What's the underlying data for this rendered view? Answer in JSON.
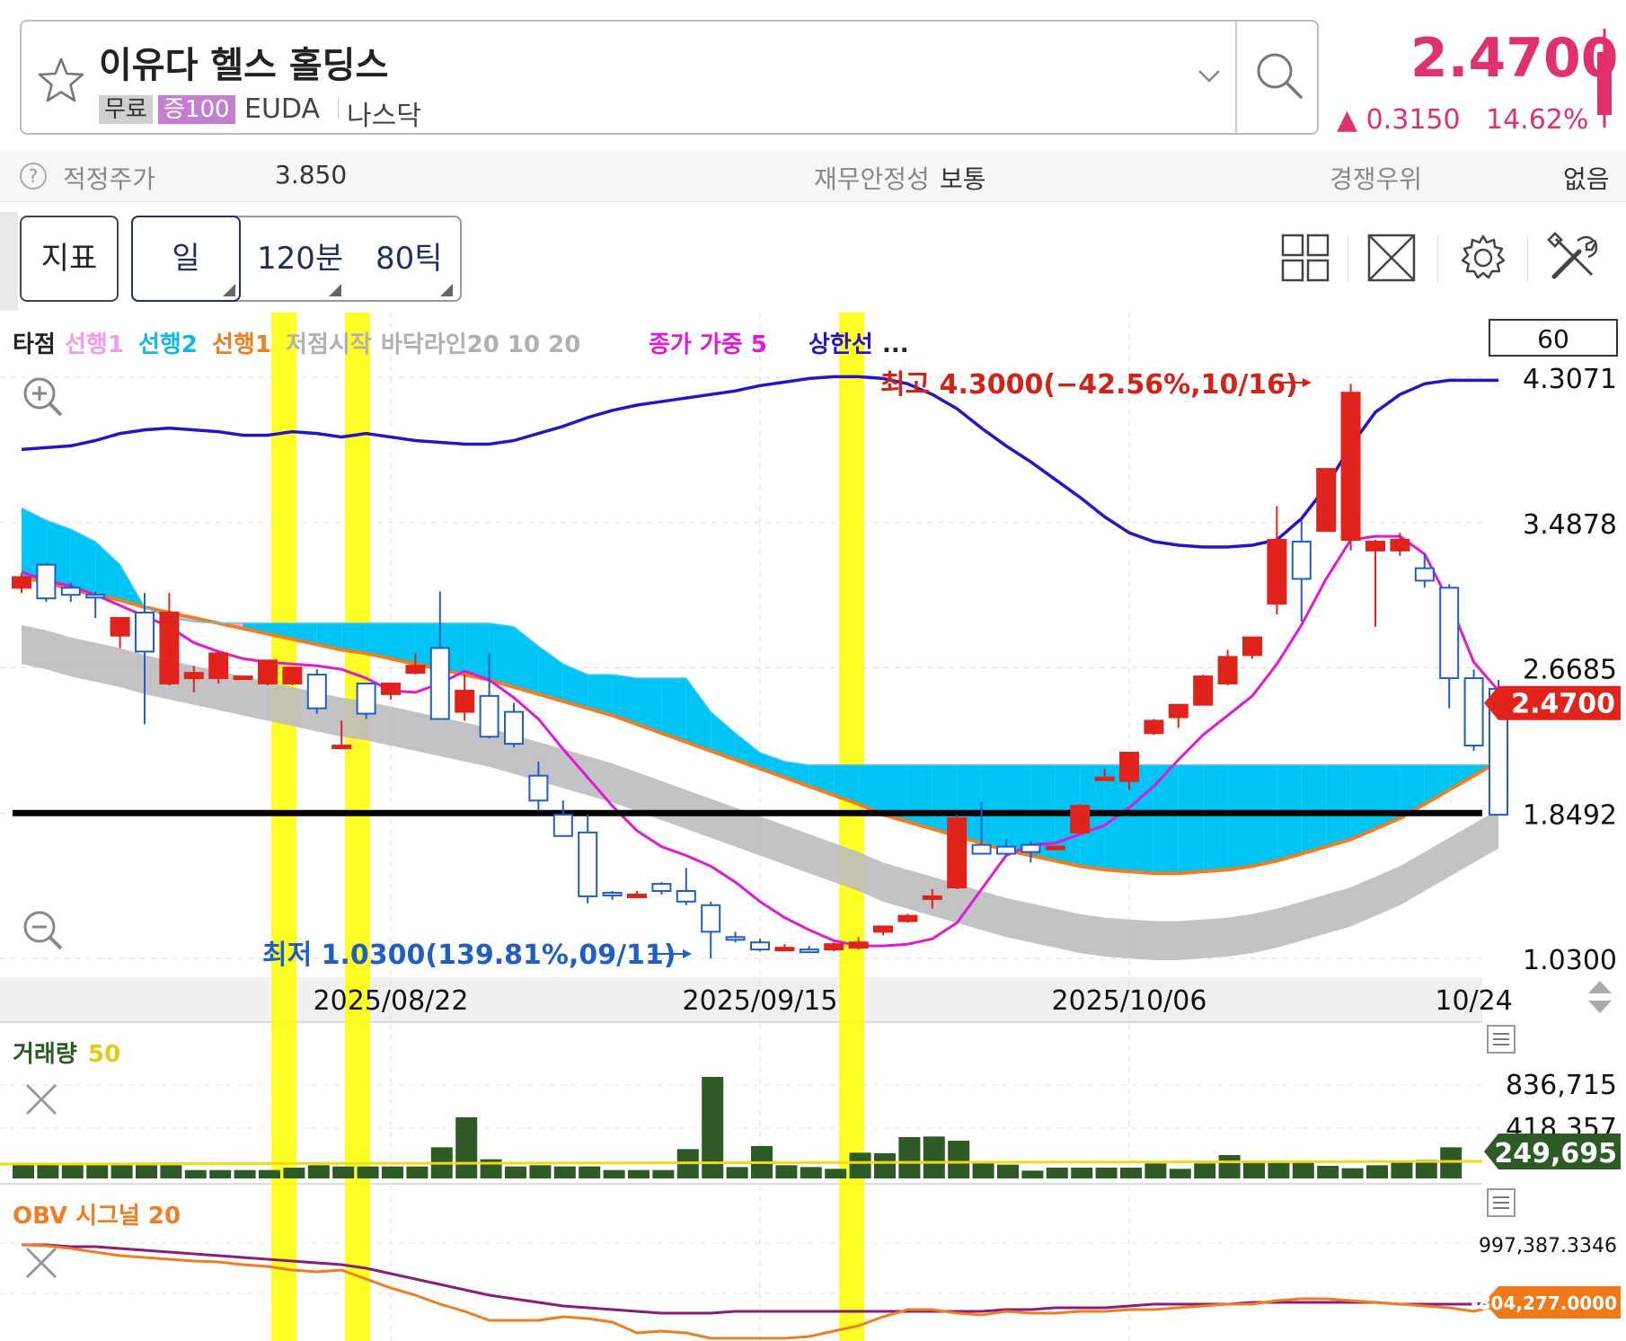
{
  "header": {
    "stock_name": "이유다 헬스 홀딩스",
    "tag_free": "무료",
    "tag_margin": "증100",
    "ticker": "EUDA",
    "market": "나스닥",
    "price": "2.4700",
    "change": "▲ 0.3150",
    "change_pct": "14.62%"
  },
  "info": {
    "fair_label": "적정주가",
    "fair_value": "3.850",
    "stability_label": "재무안정성",
    "stability_value": "보통",
    "advantage_label": "경쟁우위",
    "advantage_value": "없음"
  },
  "toolbar": {
    "indicator": "지표",
    "day": "일",
    "min120": "120분",
    "tick80": "80틱"
  },
  "legend": [
    {
      "text": "타점",
      "color": "#222222"
    },
    {
      "text": "선행1",
      "color": "#f59ae8"
    },
    {
      "text": "선행2",
      "color": "#16b7e6"
    },
    {
      "text": "선행1",
      "color": "#ef7d22"
    },
    {
      "text": "저점시작",
      "color": "#b0b0b0"
    },
    {
      "text": "바닥라인20 10 20",
      "color": "#b0b0b0"
    },
    {
      "text": "종가 가중 5",
      "color": "#e019d4"
    },
    {
      "text": "상한선",
      "color": "#2614c7"
    },
    {
      "text": "...",
      "color": "#222222"
    }
  ],
  "period_box": "60",
  "annotations": {
    "high": "최고 4.3000(−42.56%,10/16)",
    "low": "최저 1.0300(139.81%,09/11)"
  },
  "volume_label": "거래량",
  "volume_period": "50",
  "obv_label": "OBV 시그널 20",
  "colors": {
    "up": "#e0231b",
    "down": "#1f5fc4",
    "upper": "#2614c7",
    "weighted": "#e019d4",
    "cloud1": "#00c4f5",
    "cloud2": "#ffaef0",
    "leading": "#ef7d22",
    "band": "#bdbcbf",
    "highlight": "#ffff00",
    "volume": "#2e5a26",
    "obv": "#ef7d22",
    "signal": "#8a1d7a",
    "accent": "#e0306e"
  },
  "chart_data": [
    {
      "type": "candlestick",
      "x_labels": [
        "2025/08/22",
        "2025/09/15",
        "2025/10/06",
        "10/24"
      ],
      "y_ticks": [
        "4.3071",
        "3.4878",
        "2.6685",
        "1.8492",
        "1.0300"
      ],
      "ylim": [
        1.03,
        4.3071
      ],
      "last_price": "2.4700",
      "reference_line": 1.8492,
      "candles": [
        {
          "o": 3.12,
          "h": 3.2,
          "l": 3.09,
          "c": 3.18
        },
        {
          "o": 3.25,
          "h": 3.26,
          "l": 3.04,
          "c": 3.06
        },
        {
          "o": 3.12,
          "h": 3.15,
          "l": 3.04,
          "c": 3.08
        },
        {
          "o": 3.08,
          "h": 3.1,
          "l": 2.95,
          "c": 3.07
        },
        {
          "o": 2.85,
          "h": 2.92,
          "l": 2.78,
          "c": 2.95
        },
        {
          "o": 2.98,
          "h": 3.09,
          "l": 2.35,
          "c": 2.76
        },
        {
          "o": 2.58,
          "h": 3.09,
          "l": 2.57,
          "c": 2.98
        },
        {
          "o": 2.61,
          "h": 2.68,
          "l": 2.53,
          "c": 2.64
        },
        {
          "o": 2.61,
          "h": 2.66,
          "l": 2.58,
          "c": 2.75
        },
        {
          "o": 2.62,
          "h": 2.62,
          "l": 2.61,
          "c": 2.62
        },
        {
          "o": 2.58,
          "h": 2.61,
          "l": 2.57,
          "c": 2.71
        },
        {
          "o": 2.58,
          "h": 2.67,
          "l": 2.57,
          "c": 2.67
        },
        {
          "o": 2.63,
          "h": 2.66,
          "l": 2.41,
          "c": 2.44
        },
        {
          "o": 2.23,
          "h": 2.37,
          "l": 2.23,
          "c": 2.23
        },
        {
          "o": 2.58,
          "h": 2.58,
          "l": 2.38,
          "c": 2.41
        },
        {
          "o": 2.52,
          "h": 2.58,
          "l": 2.49,
          "c": 2.58
        },
        {
          "o": 2.64,
          "h": 2.75,
          "l": 2.63,
          "c": 2.68
        },
        {
          "o": 2.78,
          "h": 3.1,
          "l": 2.38,
          "c": 2.38
        },
        {
          "o": 2.42,
          "h": 2.63,
          "l": 2.37,
          "c": 2.54
        },
        {
          "o": 2.51,
          "h": 2.75,
          "l": 2.27,
          "c": 2.28
        },
        {
          "o": 2.42,
          "h": 2.47,
          "l": 2.22,
          "c": 2.24
        },
        {
          "o": 2.06,
          "h": 2.14,
          "l": 1.86,
          "c": 1.92
        },
        {
          "o": 1.84,
          "h": 1.92,
          "l": 1.72,
          "c": 1.72
        },
        {
          "o": 1.74,
          "h": 1.84,
          "l": 1.34,
          "c": 1.38
        },
        {
          "o": 1.4,
          "h": 1.41,
          "l": 1.36,
          "c": 1.39
        },
        {
          "o": 1.38,
          "h": 1.41,
          "l": 1.37,
          "c": 1.39
        },
        {
          "o": 1.45,
          "h": 1.46,
          "l": 1.39,
          "c": 1.41
        },
        {
          "o": 1.41,
          "h": 1.54,
          "l": 1.33,
          "c": 1.35
        },
        {
          "o": 1.33,
          "h": 1.35,
          "l": 1.03,
          "c": 1.18
        },
        {
          "o": 1.15,
          "h": 1.18,
          "l": 1.12,
          "c": 1.14
        },
        {
          "o": 1.12,
          "h": 1.14,
          "l": 1.07,
          "c": 1.08
        },
        {
          "o": 1.08,
          "h": 1.11,
          "l": 1.07,
          "c": 1.09
        },
        {
          "o": 1.08,
          "h": 1.1,
          "l": 1.06,
          "c": 1.07
        },
        {
          "o": 1.08,
          "h": 1.12,
          "l": 1.07,
          "c": 1.11
        },
        {
          "o": 1.09,
          "h": 1.15,
          "l": 1.08,
          "c": 1.12
        },
        {
          "o": 1.18,
          "h": 1.21,
          "l": 1.16,
          "c": 1.21
        },
        {
          "o": 1.24,
          "h": 1.28,
          "l": 1.23,
          "c": 1.27
        },
        {
          "o": 1.37,
          "h": 1.42,
          "l": 1.31,
          "c": 1.38
        },
        {
          "o": 1.43,
          "h": 1.84,
          "l": 1.42,
          "c": 1.82
        },
        {
          "o": 1.67,
          "h": 1.91,
          "l": 1.62,
          "c": 1.62
        },
        {
          "o": 1.66,
          "h": 1.7,
          "l": 1.61,
          "c": 1.62
        },
        {
          "o": 1.67,
          "h": 1.69,
          "l": 1.57,
          "c": 1.63
        },
        {
          "o": 1.65,
          "h": 1.66,
          "l": 1.64,
          "c": 1.66
        },
        {
          "o": 1.74,
          "h": 1.9,
          "l": 1.73,
          "c": 1.89
        },
        {
          "o": 2.04,
          "h": 2.1,
          "l": 2.03,
          "c": 2.05
        },
        {
          "o": 2.03,
          "h": 2.18,
          "l": 1.98,
          "c": 2.19
        },
        {
          "o": 2.3,
          "h": 2.38,
          "l": 2.29,
          "c": 2.37
        },
        {
          "o": 2.39,
          "h": 2.45,
          "l": 2.33,
          "c": 2.46
        },
        {
          "o": 2.46,
          "h": 2.63,
          "l": 2.46,
          "c": 2.62
        },
        {
          "o": 2.58,
          "h": 2.77,
          "l": 2.57,
          "c": 2.73
        },
        {
          "o": 2.74,
          "h": 2.84,
          "l": 2.72,
          "c": 2.84
        },
        {
          "o": 3.03,
          "h": 3.58,
          "l": 2.97,
          "c": 3.39
        },
        {
          "o": 3.38,
          "h": 3.5,
          "l": 2.93,
          "c": 3.17
        },
        {
          "o": 3.44,
          "h": 3.78,
          "l": 3.44,
          "c": 3.79
        },
        {
          "o": 3.39,
          "h": 4.27,
          "l": 3.33,
          "c": 4.22
        },
        {
          "o": 3.33,
          "h": 3.39,
          "l": 2.9,
          "c": 3.38
        },
        {
          "o": 3.33,
          "h": 3.43,
          "l": 3.3,
          "c": 3.39
        },
        {
          "o": 3.23,
          "h": 3.31,
          "l": 3.12,
          "c": 3.16
        },
        {
          "o": 3.12,
          "h": 3.14,
          "l": 2.44,
          "c": 2.61
        },
        {
          "o": 2.61,
          "h": 2.66,
          "l": 2.2,
          "c": 2.23
        },
        {
          "o": 2.55,
          "h": 2.6,
          "l": 1.84,
          "c": 1.84
        }
      ],
      "series": [
        {
          "name": "선행1",
          "values": [
            3.18,
            3.15,
            3.11,
            3.08,
            3.05,
            3.01,
            2.98,
            2.95,
            2.92,
            2.89,
            2.86,
            2.83,
            2.8,
            2.77,
            2.75,
            2.72,
            2.69,
            2.66,
            2.63,
            2.6,
            2.56,
            2.52,
            2.48,
            2.44,
            2.4,
            2.35,
            2.3,
            2.25,
            2.2,
            2.15,
            2.1,
            2.05,
            2.0,
            1.95,
            1.9,
            1.84,
            1.8,
            1.76,
            1.72,
            1.68,
            1.64,
            1.61,
            1.58,
            1.55,
            1.53,
            1.52,
            1.51,
            1.51,
            1.52,
            1.53,
            1.55,
            1.58,
            1.62,
            1.66,
            1.7,
            1.76,
            1.82,
            1.9,
            1.98,
            2.06,
            2.14
          ]
        },
        {
          "name": "상한선",
          "values": [
            3.9,
            3.91,
            3.92,
            3.95,
            3.99,
            4.01,
            4.02,
            4.01,
            4.0,
            3.98,
            3.98,
            4.0,
            3.99,
            3.97,
            3.99,
            3.97,
            3.95,
            3.94,
            3.93,
            3.93,
            3.95,
            3.99,
            4.03,
            4.08,
            4.12,
            4.15,
            4.17,
            4.19,
            4.21,
            4.23,
            4.26,
            4.28,
            4.3,
            4.31,
            4.31,
            4.3,
            4.27,
            4.21,
            4.13,
            4.02,
            3.92,
            3.83,
            3.73,
            3.63,
            3.52,
            3.43,
            3.38,
            3.36,
            3.35,
            3.35,
            3.36,
            3.39,
            3.51,
            3.69,
            3.92,
            4.11,
            4.21,
            4.27,
            4.29,
            4.29,
            4.29
          ]
        },
        {
          "name": "종가 가중 5",
          "values": [
            3.21,
            3.16,
            3.13,
            3.08,
            3.02,
            2.96,
            2.9,
            2.81,
            2.76,
            2.72,
            2.7,
            2.69,
            2.68,
            2.66,
            2.61,
            2.54,
            2.53,
            2.58,
            2.65,
            2.6,
            2.5,
            2.38,
            2.21,
            2.05,
            1.89,
            1.75,
            1.66,
            1.61,
            1.55,
            1.46,
            1.35,
            1.26,
            1.19,
            1.13,
            1.1,
            1.1,
            1.11,
            1.14,
            1.23,
            1.42,
            1.61,
            1.67,
            1.68,
            1.73,
            1.78,
            1.88,
            2.0,
            2.15,
            2.29,
            2.4,
            2.51,
            2.69,
            2.91,
            3.17,
            3.39,
            3.41,
            3.41,
            3.31,
            3.04,
            2.7,
            2.54
          ]
        },
        {
          "name": "선행2",
          "values": [
            3.57,
            3.5,
            3.45,
            3.38,
            3.25,
            3.01,
            2.95,
            2.93,
            2.92,
            2.92,
            2.92,
            2.92,
            2.92,
            2.92,
            2.92,
            2.92,
            2.92,
            2.92,
            2.92,
            2.92,
            2.9,
            2.79,
            2.69,
            2.63,
            2.63,
            2.61,
            2.61,
            2.61,
            2.42,
            2.3,
            2.19,
            2.14,
            2.12,
            2.12,
            2.12,
            2.12,
            2.12,
            2.12,
            2.12,
            2.12,
            2.12,
            2.12,
            2.12,
            2.12,
            2.12,
            2.12,
            2.12,
            2.12,
            2.12,
            2.12,
            2.12,
            2.12,
            2.12,
            2.12,
            2.12,
            2.12,
            2.12,
            2.12,
            2.12,
            2.12,
            2.12
          ]
        }
      ]
    },
    {
      "type": "bar",
      "title": "거래량 50",
      "y_ticks": [
        "836,715",
        "418,357"
      ],
      "last_value": "249,695",
      "values": [
        115000,
        115000,
        110000,
        110000,
        110000,
        110000,
        110000,
        70000,
        70000,
        70000,
        70000,
        90000,
        110000,
        100000,
        100000,
        100000,
        100000,
        260000,
        510000,
        160000,
        100000,
        110000,
        100000,
        100000,
        70000,
        70000,
        70000,
        245000,
        848000,
        95000,
        270000,
        110000,
        95000,
        80000,
        215000,
        210000,
        345000,
        350000,
        315000,
        140000,
        115000,
        65000,
        90000,
        90000,
        90000,
        90000,
        125000,
        80000,
        125000,
        195000,
        135000,
        150000,
        150000,
        105000,
        85000,
        110000,
        150000,
        155000,
        260000
      ]
    },
    {
      "type": "line",
      "title": "OBV 시그널 20",
      "y_ticks": [
        "997,387.3346"
      ],
      "last_value": "-804,277.0000"
    }
  ]
}
